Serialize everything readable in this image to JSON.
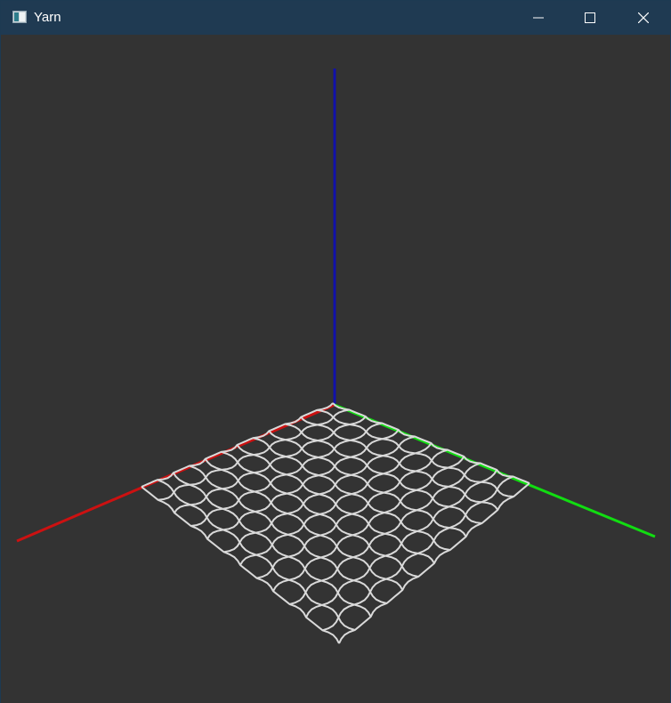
{
  "window": {
    "title": "Yarn",
    "controls": [
      "minimize",
      "maximize",
      "close"
    ],
    "title_bar_color": "#1f3a52",
    "viewport_background": "#333333"
  },
  "scene": {
    "axes": [
      {
        "name": "x-axis",
        "color": "#cc1111"
      },
      {
        "name": "y-axis",
        "color": "#11dd11"
      },
      {
        "name": "z-axis",
        "color": "#1111aa"
      }
    ],
    "mesh": {
      "color": "#d9d9d9",
      "rows": 12,
      "cols": 12
    }
  }
}
